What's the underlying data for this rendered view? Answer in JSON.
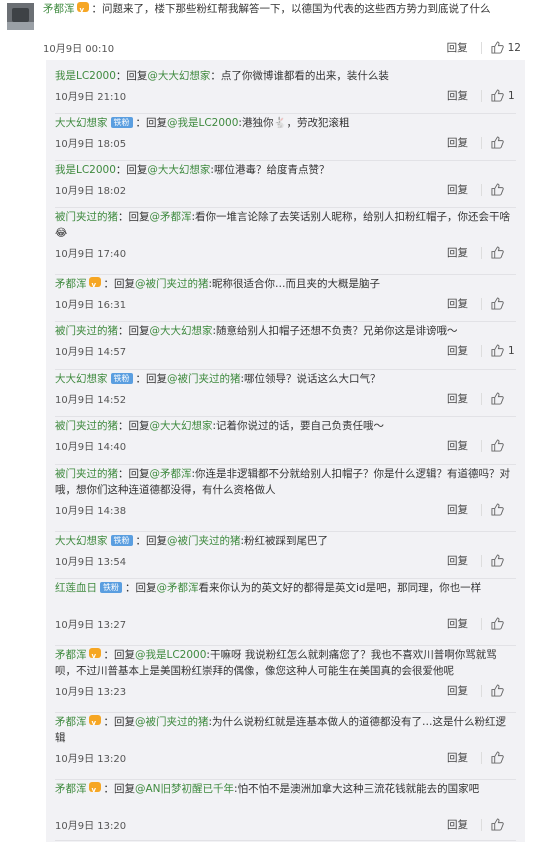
{
  "main_comment": {
    "user": "矛都浑",
    "text": "：问题来了，楼下那些粉红帮我解答一下，以德国为代表的这些西方势力到底说了什么",
    "time": "10月9日 00:10",
    "reply_label": "回复",
    "likes": "12"
  },
  "replies": [
    {
      "user": "我是LC2000",
      "verb": "：回复",
      "at": "@大大幻想家",
      "text": "：点了你微博谁都看的出来，装什么装",
      "time": "10月9日 21:10",
      "reply_label": "回复",
      "likes": "1"
    },
    {
      "user": "大大幻想家",
      "badge": "铁粉",
      "verb": "：回复",
      "at": "@我是LC2000",
      "text": ":港独你🐇，劳改犯滚粗",
      "time": "10月9日 18:05",
      "reply_label": "回复",
      "likes": ""
    },
    {
      "user": "我是LC2000",
      "verb": "：回复",
      "at": "@大大幻想家",
      "text": ":哪位港毒？给度青点赞？",
      "time": "10月9日 18:02",
      "reply_label": "回复",
      "likes": ""
    },
    {
      "user": "被门夹过的猪",
      "verb": "：回复",
      "at": "@矛都浑",
      "text": ":看你一堆言论除了去笑话别人昵称，给别人扣粉红帽子，你还会干啥😂",
      "time": "10月9日 17:40",
      "reply_label": "回复",
      "likes": ""
    },
    {
      "user": "矛都浑",
      "vip": true,
      "verb": "：回复",
      "at": "@被门夹过的猪",
      "text": ":昵称很适合你…而且夹的大概是脑子",
      "time": "10月9日 16:31",
      "reply_label": "回复",
      "likes": ""
    },
    {
      "user": "被门夹过的猪",
      "verb": "：回复",
      "at": "@大大幻想家",
      "text": ":随意给别人扣帽子还想不负责？兄弟你这是诽谤哦～",
      "time": "10月9日 14:57",
      "reply_label": "回复",
      "likes": "1"
    },
    {
      "user": "大大幻想家",
      "badge": "铁粉",
      "verb": "：回复",
      "at": "@被门夹过的猪",
      "text": ":哪位领导？说话这么大口气？",
      "time": "10月9日 14:52",
      "reply_label": "回复",
      "likes": ""
    },
    {
      "user": "被门夹过的猪",
      "verb": "：回复",
      "at": "@大大幻想家",
      "text": ":记着你说过的话，要自己负责任哦～",
      "time": "10月9日 14:40",
      "reply_label": "回复",
      "likes": ""
    },
    {
      "user": "被门夹过的猪",
      "verb": "：回复",
      "at": "@矛都浑",
      "text": ":你连是非逻辑都不分就给别人扣帽子？你是什么逻辑？有道德吗？对哦，想你们这种连道德都没得，有什么资格做人",
      "time": "10月9日 14:38",
      "reply_label": "回复",
      "likes": ""
    },
    {
      "user": "大大幻想家",
      "badge": "铁粉",
      "verb": "：回复",
      "at": "@被门夹过的猪",
      "text": ":粉红被踩到尾巴了",
      "time": "10月9日 13:54",
      "reply_label": "回复",
      "likes": ""
    },
    {
      "user": "红莲血日",
      "badge": "铁粉",
      "verb": "：回复",
      "at": "@矛都浑",
      "text": "看来你认为的英文好的都得是英文id是吧，那同理，你也一样",
      "time": "10月9日 13:27",
      "reply_label": "回复",
      "likes": ""
    },
    {
      "user": "矛都浑",
      "vip": true,
      "verb": "：回复",
      "at": "@我是LC2000",
      "text": ":干嘛呀 我说粉红怎么就刺痛您了？我也不喜欢川普啊你骂就骂呗，不过川普基本上是美国粉红崇拜的偶像，像您这种人可能生在美国真的会很爱他呢",
      "time": "10月9日 13:23",
      "reply_label": "回复",
      "likes": ""
    },
    {
      "user": "矛都浑",
      "vip": true,
      "verb": "：回复",
      "at": "@被门夹过的猪",
      "text": ":为什么说粉红就是连基本做人的道德都没有了…这是什么粉红逻辑",
      "time": "10月9日 13:20",
      "reply_label": "回复",
      "likes": ""
    },
    {
      "user": "矛都浑",
      "vip": true,
      "verb": "：回复",
      "at": "@AN旧梦初醒已千年",
      "text": ":怕不怕不是澳洲加拿大这种三流花钱就能去的国家吧",
      "time": "10月9日 13:20",
      "reply_label": "回复",
      "likes": ""
    }
  ]
}
